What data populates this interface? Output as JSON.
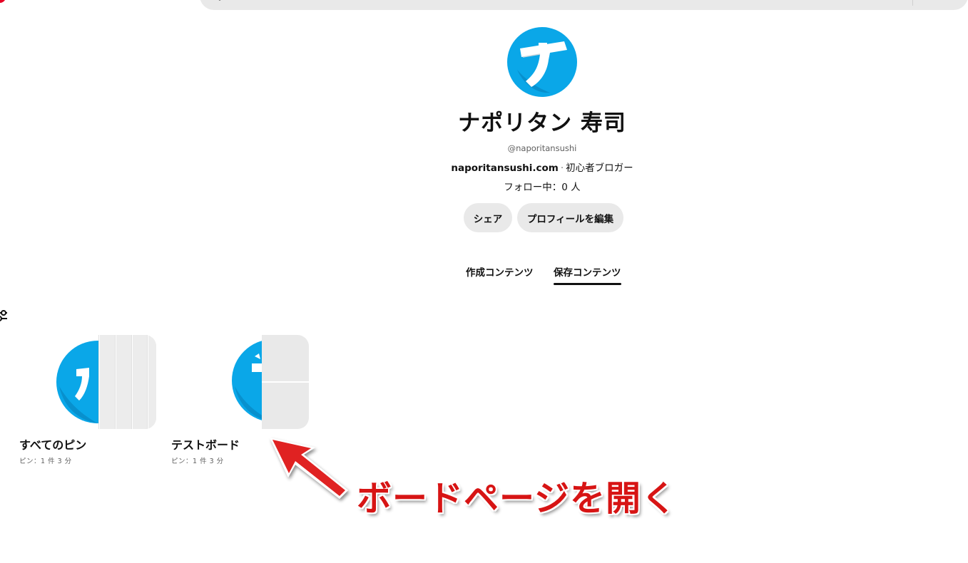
{
  "header": {
    "search_placeholder": "・",
    "brand_color": "#e60023"
  },
  "profile": {
    "name": "ナポリタン 寿司",
    "handle": "@naporitansushi",
    "website": "naporitansushi.com",
    "separator": "·",
    "bio": "初心者ブロガー",
    "following": "フォロー中：0 人",
    "avatar_icon": "avatar-image"
  },
  "actions": {
    "share_label": "シェア",
    "edit_label": "プロフィールを編集"
  },
  "tabs": [
    {
      "label": "作成コンテンツ",
      "active": false
    },
    {
      "label": "保存コンテンツ",
      "active": true
    }
  ],
  "boards": [
    {
      "title": "すべてのピン",
      "meta": "ピン：1 件  3 分"
    },
    {
      "title": "テストボード",
      "meta": "ピン：1 件  3 分"
    }
  ],
  "annotation": {
    "text": "ボードページを開く",
    "color": "#d71414"
  }
}
